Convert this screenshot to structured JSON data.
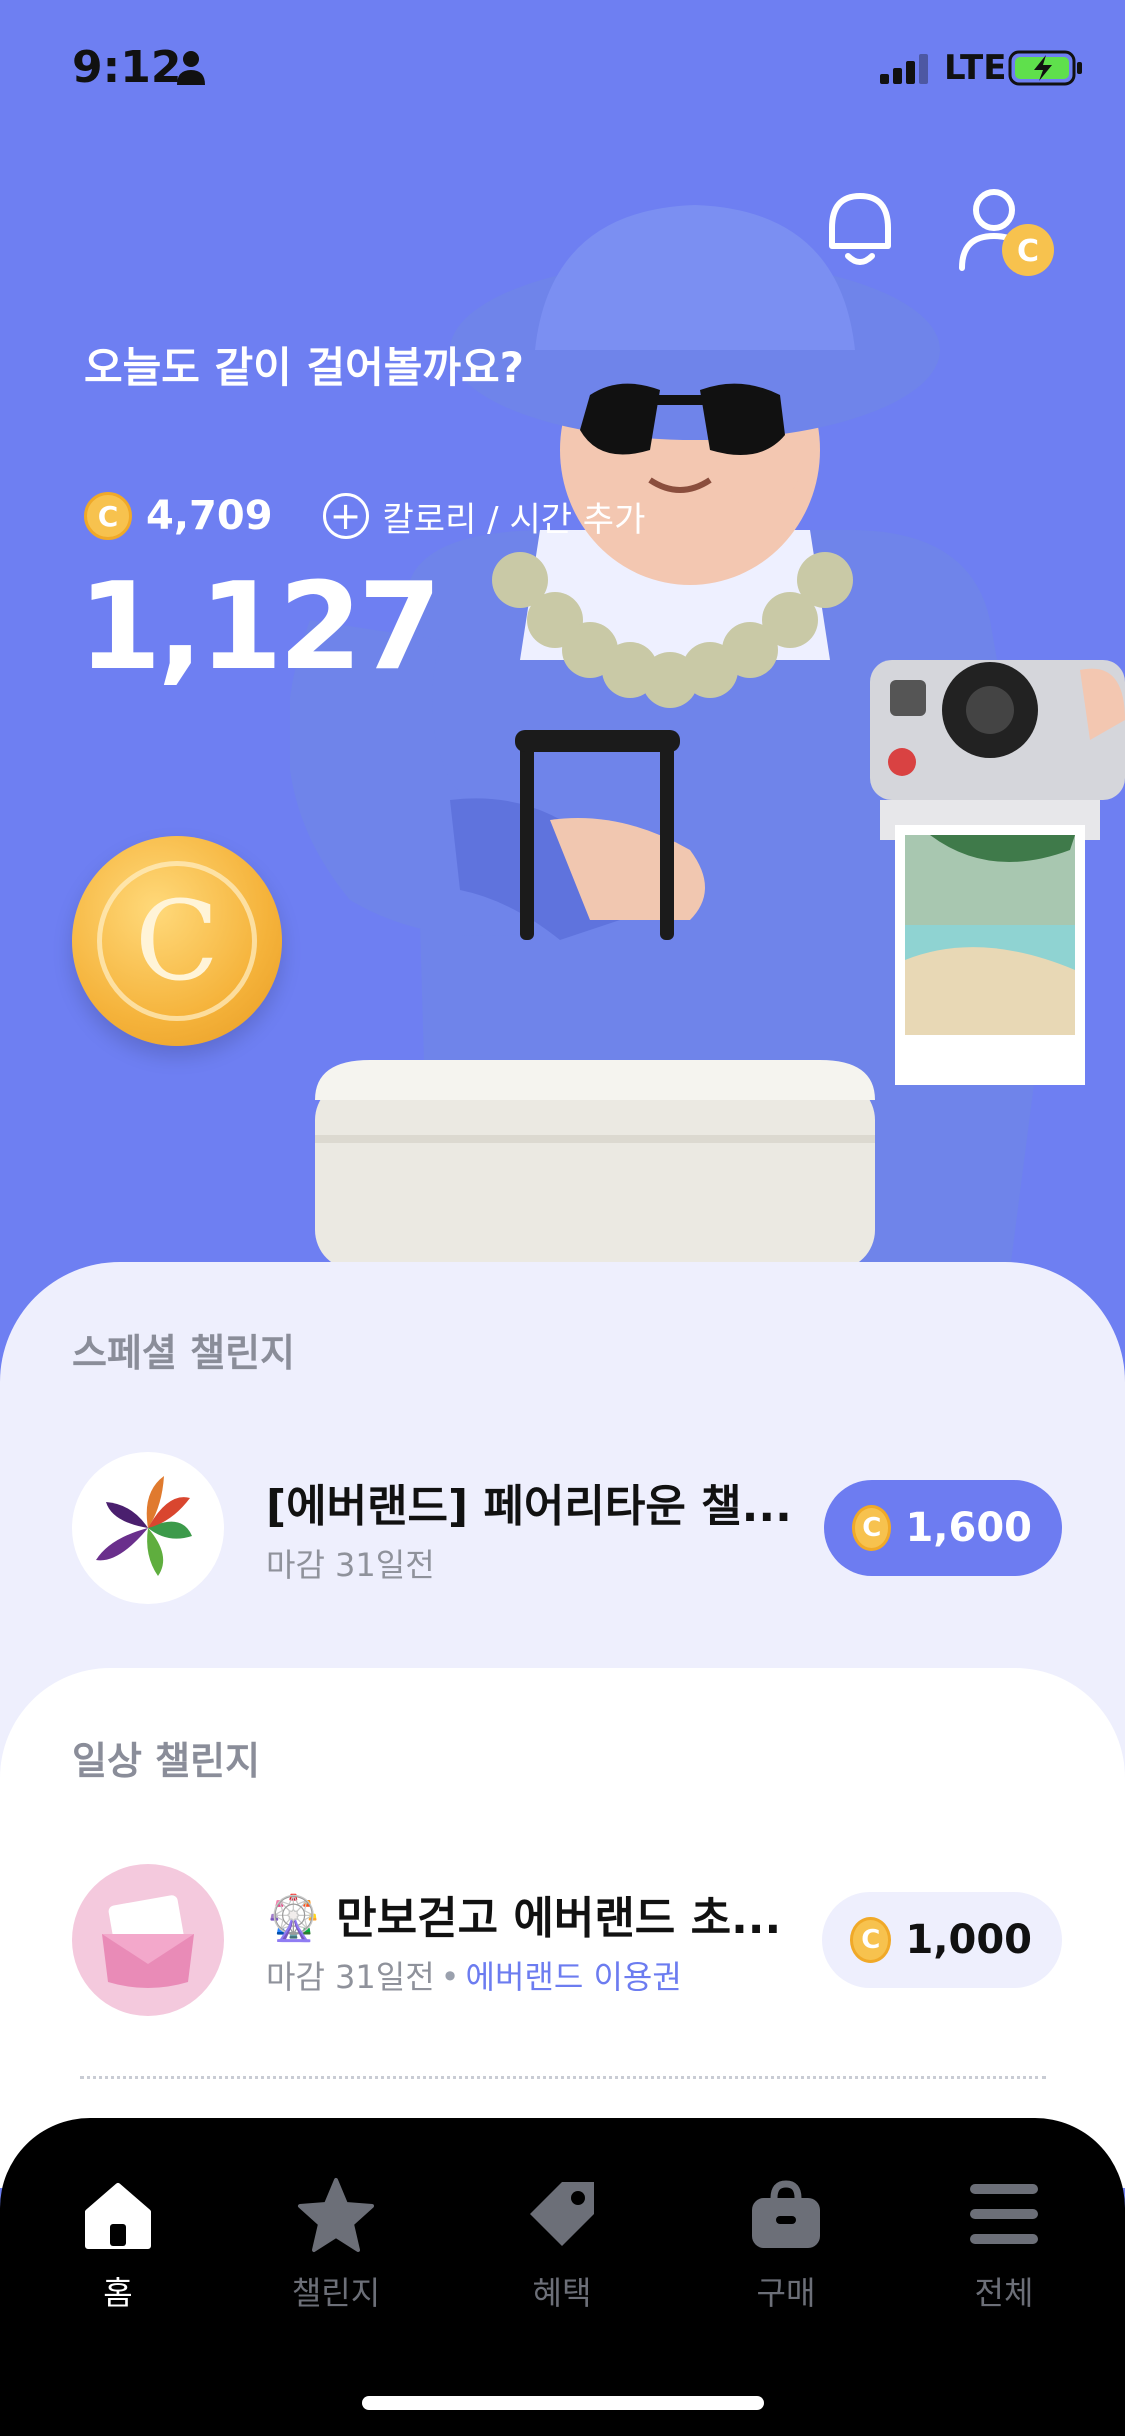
{
  "status_bar": {
    "time": "9:12",
    "network": "LTE"
  },
  "hero": {
    "greeting": "오늘도 같이 걸어볼까요?",
    "points": "4,709",
    "coin_symbol": "C",
    "add_label": "칼로리 / 시간 추가",
    "steps": "1,127",
    "icons": [
      "bell-icon",
      "profile-coin-icon",
      "plus-circle-icon",
      "coin-icon"
    ]
  },
  "special": {
    "section_title": "스페셜 챌린지",
    "items": [
      {
        "title": "[에버랜드] 페어리타운 챌...",
        "deadline": "마감 31일전",
        "reward": "1,600"
      }
    ]
  },
  "daily": {
    "section_title": "일상 챌린지",
    "items": [
      {
        "title": "만보걷고 에버랜드 초...",
        "deadline": "마감 31일전",
        "tag": "에버랜드 이용권",
        "reward": "1,000",
        "emoji": "🎡"
      }
    ]
  },
  "nav": {
    "items": [
      {
        "label": "홈",
        "icon": "home-icon",
        "active": true
      },
      {
        "label": "챌린지",
        "icon": "star-icon",
        "active": false
      },
      {
        "label": "혜택",
        "icon": "tag-icon",
        "active": false
      },
      {
        "label": "구매",
        "icon": "bag-icon",
        "active": false
      },
      {
        "label": "전체",
        "icon": "menu-icon",
        "active": false
      }
    ]
  },
  "colors": {
    "hero_bg": "#6e7ff2",
    "accent": "#6d7cf1",
    "coin": "#f7c24e",
    "sheet": "#eeeffd"
  }
}
